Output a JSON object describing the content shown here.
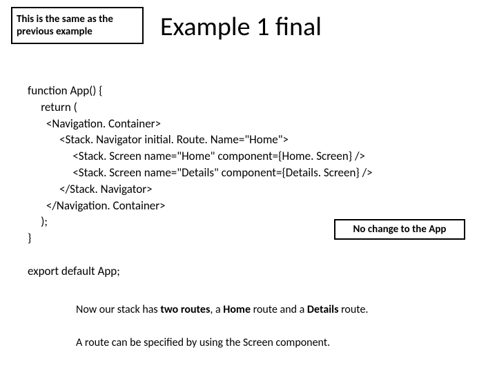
{
  "header": {
    "note": "This is the same as the previous example",
    "title": "Example 1 final"
  },
  "code": {
    "l1": "function App() {",
    "l2": "     return (",
    "l3": "       <Navigation. Container>",
    "l4": "            <Stack. Navigator initial. Route. Name=\"Home\">",
    "l5": "                 <Stack. Screen name=\"Home\" component={Home. Screen} />",
    "l6": "                 <Stack. Screen name=\"Details\" component={Details. Screen} />",
    "l7": "            </Stack. Navigator>",
    "l8": "       </Navigation. Container>",
    "l9": "     );",
    "l10": "}",
    "l11": "",
    "l12": "export default App;"
  },
  "callout": "No change to the App",
  "para1": {
    "pre": "Now our stack has ",
    "b1": "two routes",
    "mid1": ", a ",
    "b2": "Home",
    "mid2": " route and a ",
    "b3": "Details",
    "post": " route."
  },
  "para2": "A route can be specified by using the Screen component."
}
